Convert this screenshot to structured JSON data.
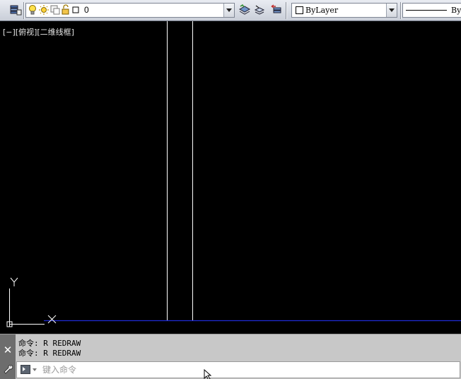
{
  "toolbar": {
    "layer_combo_value": "0",
    "color_combo_value": "ByLayer",
    "linetype_combo_value": "ByLayer"
  },
  "viewport": {
    "label": "[−][俯视][二维线框]"
  },
  "ucs": {
    "y_label": "Y",
    "x_label": "X"
  },
  "command_line": {
    "history": [
      "命令: R REDRAW",
      "命令: R REDRAW"
    ],
    "placeholder": "键入命令",
    "value": ""
  },
  "colors": {
    "canvas_background": "#000000",
    "drawing_lines": "#ffffff",
    "axis_line": "#1e2bd6"
  }
}
